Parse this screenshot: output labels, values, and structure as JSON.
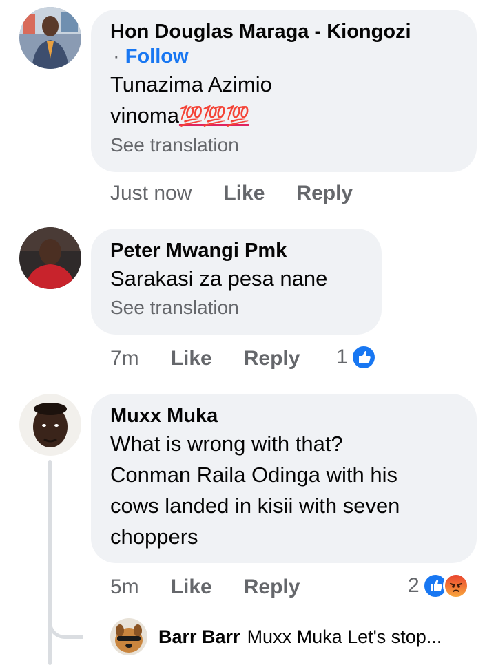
{
  "comments": [
    {
      "author": "Hon Douglas Maraga - Kiongozi",
      "follow_prefix": "·",
      "follow": "Follow",
      "text_line1": "Tunazima Azimio",
      "text_line2": "vinoma",
      "emoji": "💯💯💯",
      "translate": "See translation",
      "time": "Just now",
      "like": "Like",
      "reply": "Reply"
    },
    {
      "author": "Peter Mwangi Pmk",
      "text": "Sarakasi za pesa nane",
      "translate": "See translation",
      "time": "7m",
      "like": "Like",
      "reply": "Reply",
      "reaction_count": "1",
      "reaction_icons": [
        "like-icon"
      ]
    },
    {
      "author": "Muxx Muka",
      "text_lines": [
        "What is wrong with that?",
        "Conman Raila Odinga with his",
        "cows landed in kisii with seven",
        "choppers"
      ],
      "time": "5m",
      "like": "Like",
      "reply": "Reply",
      "reaction_count": "2",
      "reaction_icons": [
        "like-icon",
        "angry-icon"
      ]
    }
  ],
  "reply_preview": {
    "author": "Barr Barr",
    "text": "Muxx Muka Let's stop..."
  },
  "colors": {
    "bubble": "#f0f2f5",
    "link_blue": "#1877f2",
    "muted": "#65676b"
  }
}
